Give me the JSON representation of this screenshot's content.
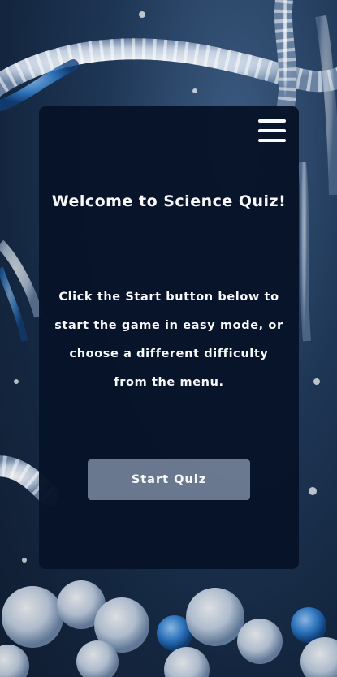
{
  "menu": {
    "icon": "hamburger-menu-icon"
  },
  "main": {
    "title": "Welcome to Science Quiz!",
    "instructions": "Click the Start button below to start the game in easy mode, or choose a different difficulty from the menu.",
    "start_label": "Start Quiz"
  },
  "colors": {
    "card_background": "#071328",
    "button_background": "#6d7b92",
    "text": "#ffffff"
  }
}
